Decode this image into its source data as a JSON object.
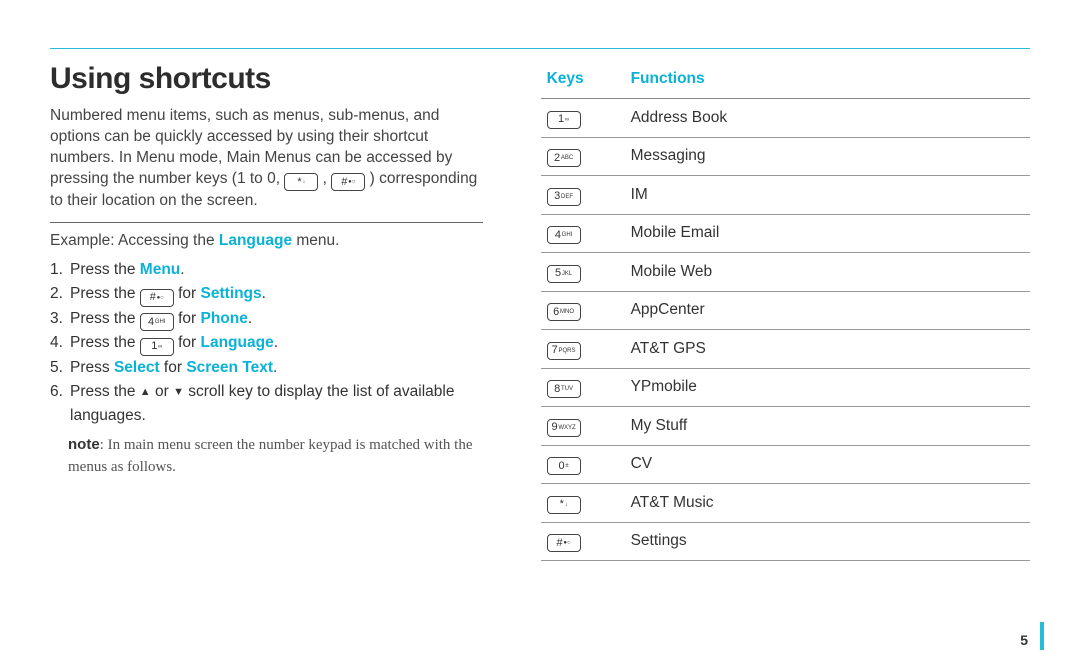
{
  "page_number": "5",
  "heading": "Using shortcuts",
  "intro_parts": {
    "p1": "Numbered menu items, such as menus, sub-menus, and options can be quickly accessed by using their shortcut numbers. In Menu mode, Main Menus can be accessed by pressing the number keys (1 to 0,",
    "p2": ",",
    "p3": ") corresponding to their location on the screen."
  },
  "example": {
    "prefix": "Example: Accessing the ",
    "kw": "Language",
    "suffix": " menu."
  },
  "steps": [
    {
      "pre": "Press the ",
      "kw": "Menu",
      "post": "."
    },
    {
      "pre": "Press the ",
      "key": {
        "main": "#",
        "sub": "●○"
      },
      "mid": " for ",
      "kw": "Settings",
      "post": "."
    },
    {
      "pre": "Press the ",
      "key": {
        "main": "4",
        "sub": "GHI"
      },
      "mid": " for ",
      "kw": "Phone",
      "post": "."
    },
    {
      "pre": "Press the ",
      "key": {
        "main": "1",
        "sub": "∞"
      },
      "mid": " for ",
      "kw": "Language",
      "post": "."
    },
    {
      "pre": "Press ",
      "kw": "Select",
      "mid2": " for ",
      "kw2": "Screen Text",
      "post": "."
    },
    {
      "pre": "Press the ",
      "tri_up": "▲",
      "mid": " or ",
      "tri_down": "▼",
      "post": " scroll key to display the list of available languages."
    }
  ],
  "note": {
    "label": "note",
    "text": ": In main menu screen the number keypad is matched with the menus as follows."
  },
  "table": {
    "headers": {
      "keys": "Keys",
      "functions": "Functions"
    },
    "rows": [
      {
        "key": {
          "main": "1",
          "sub": "∞"
        },
        "fn": "Address Book"
      },
      {
        "key": {
          "main": "2",
          "sub": "ABC"
        },
        "fn": "Messaging"
      },
      {
        "key": {
          "main": "3",
          "sub": "DEF"
        },
        "fn": "IM"
      },
      {
        "key": {
          "main": "4",
          "sub": "GHI"
        },
        "fn": "Mobile Email"
      },
      {
        "key": {
          "main": "5",
          "sub": "JKL"
        },
        "fn": "Mobile Web"
      },
      {
        "key": {
          "main": "6",
          "sub": "MNO"
        },
        "fn": "AppCenter"
      },
      {
        "key": {
          "main": "7",
          "sub": "PQRS"
        },
        "fn": "AT&T GPS"
      },
      {
        "key": {
          "main": "8",
          "sub": "TUV"
        },
        "fn": "YPmobile"
      },
      {
        "key": {
          "main": "9",
          "sub": "WXYZ"
        },
        "fn": "My Stuff"
      },
      {
        "key": {
          "main": "0",
          "sub": "±"
        },
        "fn": "CV"
      },
      {
        "key": {
          "main": "*",
          "sub": "↓"
        },
        "fn": "AT&T Music"
      },
      {
        "key": {
          "main": "#",
          "sub": "●○"
        },
        "fn": "Settings"
      }
    ]
  }
}
